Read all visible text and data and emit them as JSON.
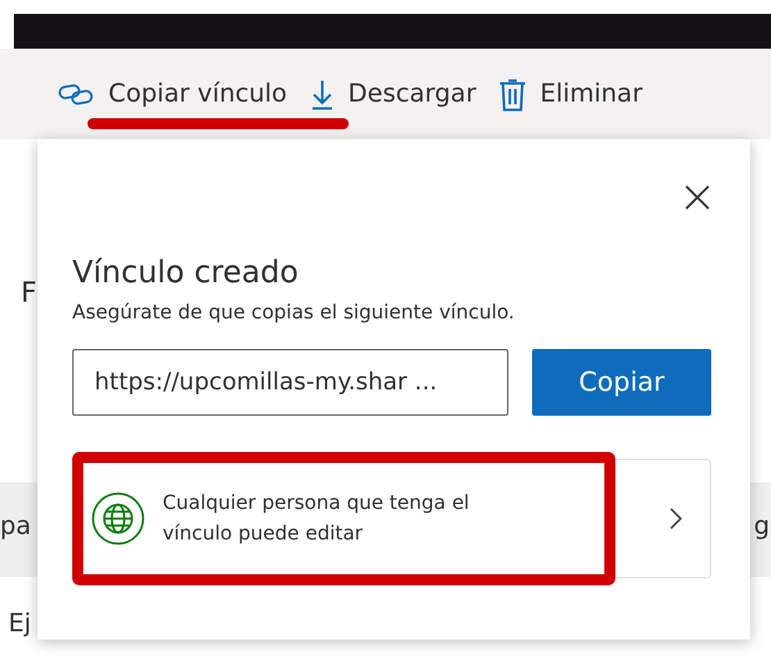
{
  "toolbar": {
    "items": [
      {
        "kind": "link",
        "label": "Copiar vínculo"
      },
      {
        "kind": "download",
        "label": "Descargar"
      },
      {
        "kind": "trash",
        "label": "Eliminar"
      }
    ]
  },
  "background": {
    "fragments": [
      "F",
      "pa",
      "g",
      "Ej"
    ]
  },
  "dialog": {
    "title": "Vínculo creado",
    "subtitle": "Asegúrate de que copias el siguiente vínculo.",
    "link_value": "https://upcomillas-my.shar ...",
    "copy_button": "Copiar",
    "permission": "Cualquier persona que tenga el vínculo puede editar"
  }
}
